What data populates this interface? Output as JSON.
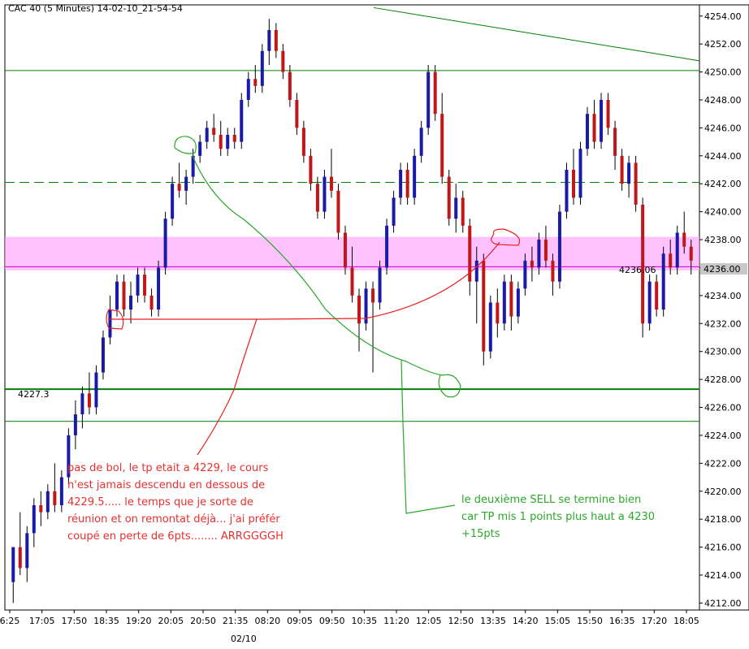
{
  "chart_data": {
    "type": "candlestick",
    "title": "CAC 40 (5 Minutes) 14-02-10_21-54-54",
    "ylim": [
      4211.5,
      4254.8
    ],
    "y_ticks": [
      4254,
      4252,
      4250,
      4248,
      4246,
      4244,
      4242,
      4240,
      4238,
      4236,
      4234,
      4232,
      4230,
      4228,
      4226,
      4224,
      4222,
      4220,
      4218,
      4216,
      4214,
      4212
    ],
    "y_tick_labels": [
      "4254.00",
      "4252.00",
      "4250.00",
      "4248.00",
      "4246.00",
      "4244.00",
      "4242.00",
      "4240.00",
      "4238.00",
      "4236.00",
      "4234.00",
      "4232.00",
      "4230.00",
      "4228.00",
      "4226.00",
      "4224.00",
      "4222.00",
      "4220.00",
      "4218.00",
      "4216.00",
      "4214.00",
      "4212.00"
    ],
    "x_tick_labels": [
      "6:25",
      "17:05",
      "17:50",
      "18:35",
      "19:20",
      "20:05",
      "20:50",
      "21:35",
      "08:20",
      "09:05",
      "09:50",
      "10:35",
      "11:20",
      "12:05",
      "12:50",
      "13:35",
      "14:20",
      "15:05",
      "15:50",
      "16:35",
      "17:20",
      "18:05"
    ],
    "date_label": "02/10",
    "current_price_label": "4236.00",
    "level_labels": [
      "4227.3",
      "4236.06"
    ],
    "horizontal_levels": [
      {
        "price": 4250.1,
        "style": "solid",
        "color": "#008000"
      },
      {
        "price": 4242.1,
        "style": "dashed",
        "color": "#008000"
      },
      {
        "price": 4227.3,
        "style": "solid-thick",
        "color": "#008000"
      },
      {
        "price": 4225.0,
        "style": "solid",
        "color": "#008000"
      },
      {
        "price": 4236.06,
        "style": "solid",
        "color": "#cc00cc"
      }
    ],
    "zone": {
      "from": 4235.8,
      "to": 4238.2,
      "color": "#ff99ff"
    },
    "trendline": {
      "from_price": 4254.6,
      "to_price": 4250.8,
      "color": "#008000"
    },
    "candles": [
      [
        4213.5,
        4216.0,
        4212.0,
        4216.0
      ],
      [
        4216.0,
        4218.5,
        4214.0,
        4214.5
      ],
      [
        4214.5,
        4217.5,
        4213.5,
        4217.0
      ],
      [
        4217.0,
        4219.5,
        4216.0,
        4219.0
      ],
      [
        4219.0,
        4220.0,
        4217.5,
        4218.5
      ],
      [
        4218.5,
        4220.5,
        4218.0,
        4220.0
      ],
      [
        4220.0,
        4222.0,
        4218.5,
        4219.0
      ],
      [
        4219.0,
        4221.5,
        4218.5,
        4221.0
      ],
      [
        4221.0,
        4224.5,
        4220.5,
        4224.0
      ],
      [
        4224.0,
        4226.5,
        4223.0,
        4225.5
      ],
      [
        4225.5,
        4227.5,
        4224.5,
        4227.0
      ],
      [
        4227.0,
        4228.5,
        4225.5,
        4226.0
      ],
      [
        4226.0,
        4229.0,
        4225.5,
        4228.5
      ],
      [
        4228.5,
        4231.5,
        4228.0,
        4231.0
      ],
      [
        4231.0,
        4234.0,
        4230.5,
        4233.0
      ],
      [
        4233.0,
        4235.5,
        4232.5,
        4235.0
      ],
      [
        4235.0,
        4235.5,
        4232.5,
        4233.0
      ],
      [
        4233.0,
        4235.0,
        4232.0,
        4234.0
      ],
      [
        4234.0,
        4236.0,
        4233.5,
        4235.5
      ],
      [
        4235.5,
        4236.0,
        4233.5,
        4234.0
      ],
      [
        4234.0,
        4234.5,
        4232.5,
        4233.0
      ],
      [
        4233.0,
        4236.5,
        4232.5,
        4236.0
      ],
      [
        4236.0,
        4240.0,
        4235.5,
        4239.5
      ],
      [
        4239.5,
        4242.5,
        4239.0,
        4242.0
      ],
      [
        4242.0,
        4243.5,
        4241.0,
        4241.5
      ],
      [
        4241.5,
        4243.0,
        4240.5,
        4242.5
      ],
      [
        4242.5,
        4244.5,
        4242.0,
        4244.0
      ],
      [
        4244.0,
        4245.5,
        4243.5,
        4245.0
      ],
      [
        4245.0,
        4246.5,
        4244.5,
        4246.0
      ],
      [
        4246.0,
        4247.0,
        4245.0,
        4245.5
      ],
      [
        4245.5,
        4246.5,
        4244.0,
        4244.5
      ],
      [
        4244.5,
        4246.0,
        4244.0,
        4245.5
      ],
      [
        4245.5,
        4246.0,
        4244.5,
        4245.0
      ],
      [
        4245.0,
        4248.5,
        4244.5,
        4248.0
      ],
      [
        4248.0,
        4250.0,
        4247.5,
        4249.5
      ],
      [
        4249.5,
        4250.5,
        4248.5,
        4249.0
      ],
      [
        4249.0,
        4252.0,
        4248.5,
        4251.5
      ],
      [
        4251.5,
        4253.8,
        4250.5,
        4253.0
      ],
      [
        4253.0,
        4253.5,
        4251.0,
        4251.5
      ],
      [
        4251.5,
        4252.0,
        4249.5,
        4250.0
      ],
      [
        4250.0,
        4250.5,
        4247.5,
        4248.0
      ],
      [
        4248.0,
        4248.5,
        4245.5,
        4246.0
      ],
      [
        4246.0,
        4246.5,
        4243.5,
        4244.0
      ],
      [
        4244.0,
        4244.5,
        4241.5,
        4242.0
      ],
      [
        4242.0,
        4242.5,
        4239.5,
        4240.0
      ],
      [
        4240.0,
        4243.0,
        4239.5,
        4242.5
      ],
      [
        4242.5,
        4244.5,
        4241.0,
        4241.5
      ],
      [
        4241.5,
        4242.0,
        4238.0,
        4238.5
      ],
      [
        4238.5,
        4239.0,
        4235.5,
        4236.0
      ],
      [
        4236.0,
        4237.5,
        4233.5,
        4234.0
      ],
      [
        4234.0,
        4234.5,
        4230.0,
        4232.0
      ],
      [
        4232.0,
        4235.0,
        4231.5,
        4234.5
      ],
      [
        4234.5,
        4235.0,
        4228.5,
        4233.5
      ],
      [
        4233.5,
        4236.5,
        4233.0,
        4236.0
      ],
      [
        4236.0,
        4239.5,
        4235.5,
        4239.0
      ],
      [
        4239.0,
        4241.5,
        4238.5,
        4241.0
      ],
      [
        4241.0,
        4243.5,
        4240.5,
        4243.0
      ],
      [
        4243.0,
        4243.5,
        4240.5,
        4241.0
      ],
      [
        4241.0,
        4244.5,
        4240.5,
        4244.0
      ],
      [
        4244.0,
        4246.5,
        4243.5,
        4246.0
      ],
      [
        4246.0,
        4250.5,
        4245.5,
        4250.0
      ],
      [
        4250.0,
        4250.5,
        4246.5,
        4247.0
      ],
      [
        4247.0,
        4248.5,
        4242.0,
        4242.5
      ],
      [
        4242.5,
        4243.0,
        4239.0,
        4239.5
      ],
      [
        4239.5,
        4242.0,
        4238.5,
        4241.0
      ],
      [
        4241.0,
        4241.5,
        4238.5,
        4239.0
      ],
      [
        4239.0,
        4239.5,
        4234.0,
        4235.0
      ],
      [
        4235.0,
        4237.5,
        4232.0,
        4236.5
      ],
      [
        4236.5,
        4237.0,
        4229.0,
        4230.0
      ],
      [
        4230.0,
        4234.0,
        4229.5,
        4233.5
      ],
      [
        4233.5,
        4234.5,
        4231.0,
        4232.0
      ],
      [
        4232.0,
        4235.5,
        4231.5,
        4235.0
      ],
      [
        4235.0,
        4235.5,
        4231.5,
        4232.5
      ],
      [
        4232.5,
        4235.0,
        4232.0,
        4234.5
      ],
      [
        4234.5,
        4237.0,
        4234.0,
        4236.5
      ],
      [
        4236.5,
        4237.5,
        4235.0,
        4236.0
      ],
      [
        4236.0,
        4238.5,
        4235.5,
        4238.0
      ],
      [
        4238.0,
        4239.0,
        4236.0,
        4236.5
      ],
      [
        4236.5,
        4237.0,
        4234.0,
        4235.0
      ],
      [
        4235.0,
        4240.5,
        4234.5,
        4240.0
      ],
      [
        4240.0,
        4243.5,
        4239.5,
        4243.0
      ],
      [
        4243.0,
        4244.5,
        4240.5,
        4241.0
      ],
      [
        4241.0,
        4245.0,
        4240.5,
        4244.5
      ],
      [
        4244.5,
        4247.5,
        4244.0,
        4247.0
      ],
      [
        4247.0,
        4248.0,
        4244.5,
        4245.0
      ],
      [
        4245.0,
        4248.5,
        4244.5,
        4248.0
      ],
      [
        4248.0,
        4248.5,
        4245.5,
        4246.0
      ],
      [
        4246.0,
        4246.5,
        4243.0,
        4244.0
      ],
      [
        4244.0,
        4244.5,
        4241.5,
        4242.0
      ],
      [
        4242.0,
        4244.0,
        4241.0,
        4243.5
      ],
      [
        4243.5,
        4244.0,
        4240.0,
        4240.5
      ],
      [
        4240.5,
        4241.0,
        4231.0,
        4232.0
      ],
      [
        4232.0,
        4235.5,
        4231.5,
        4235.0
      ],
      [
        4235.0,
        4235.5,
        4232.5,
        4233.0
      ],
      [
        4233.0,
        4237.5,
        4232.5,
        4237.0
      ],
      [
        4237.0,
        4238.0,
        4235.5,
        4236.0
      ],
      [
        4236.0,
        4239.0,
        4235.5,
        4238.5
      ],
      [
        4238.5,
        4240.0,
        4237.0,
        4237.5
      ],
      [
        4237.5,
        4238.0,
        4235.5,
        4236.5
      ]
    ],
    "annotations": [
      {
        "color": "#e83030",
        "lines": [
          "pas de bol, le tp etait a 4229, le cours",
          "n'est jamais descendu en dessous de",
          "4229.5..... le temps que je sorte de",
          "réunion et on remontat déjà... j'ai préfér",
          "coupé en perte de 6pts........ ARRGGGGH"
        ]
      },
      {
        "color": "#2aa82a",
        "lines": [
          "le deuxième SELL se termine bien",
          "car TP mis 1 points plus haut a 4230",
          "+15pts"
        ]
      }
    ]
  }
}
